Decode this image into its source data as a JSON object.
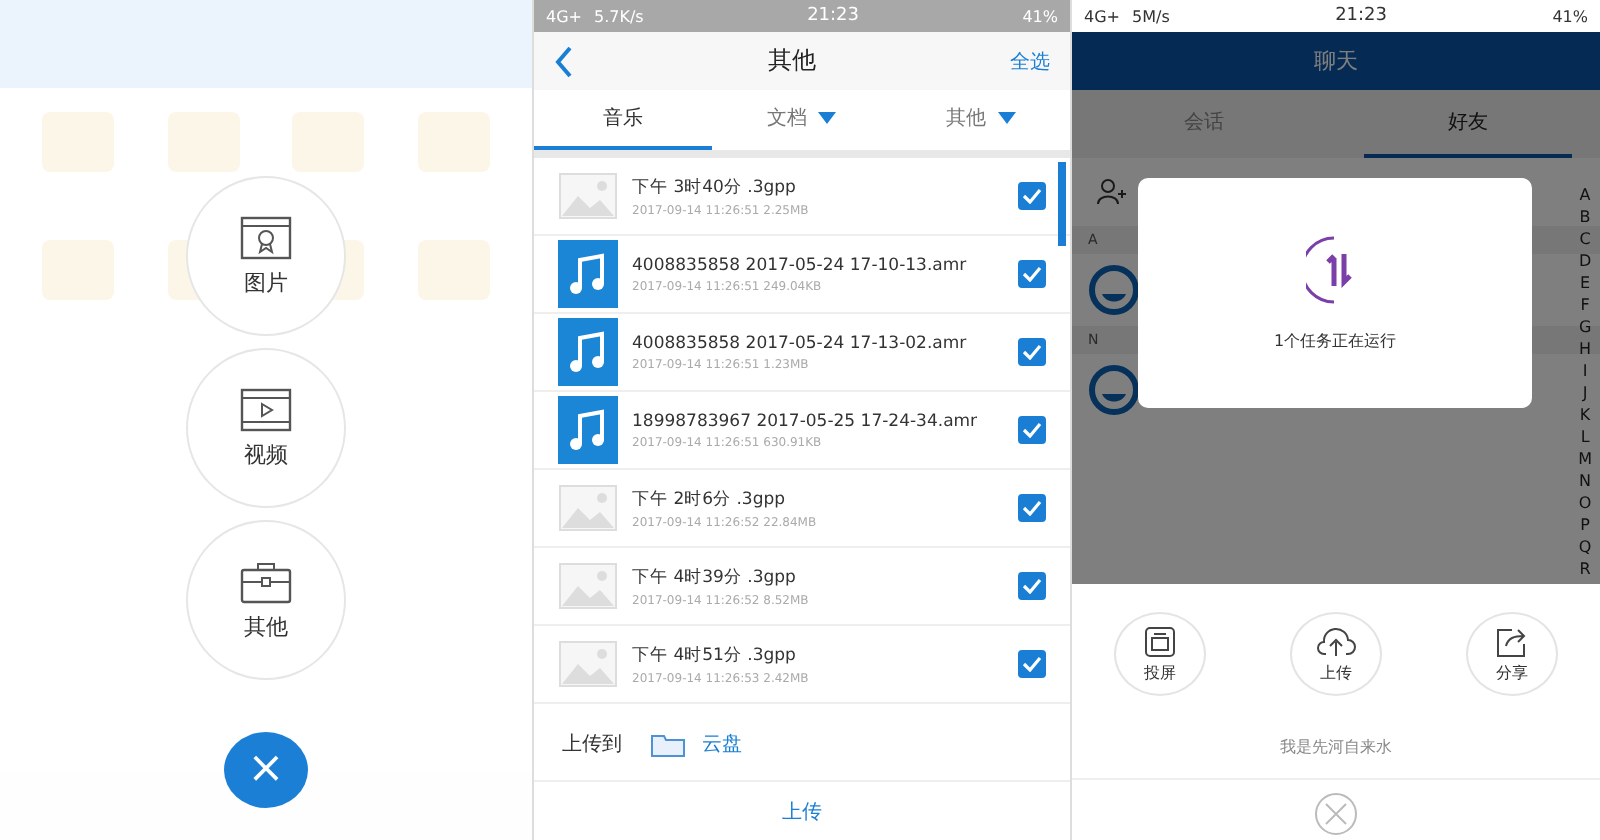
{
  "menu_screen": {
    "options": [
      {
        "label": "图片",
        "kind": "picture"
      },
      {
        "label": "视频",
        "kind": "video"
      },
      {
        "label": "其他",
        "kind": "other"
      }
    ],
    "close": "×"
  },
  "file_screen": {
    "status_bar": {
      "network": "4G+",
      "speed": "5.7K/s",
      "time": "21:23",
      "battery": "41%"
    },
    "title": "其他",
    "select_all": "全选",
    "tabs": [
      {
        "label": "音乐",
        "selected": true,
        "dropdown": false
      },
      {
        "label": "文档",
        "selected": false,
        "dropdown": true
      },
      {
        "label": "其他",
        "selected": false,
        "dropdown": true
      }
    ],
    "files": [
      {
        "name": "下午 3时40分 .3gpp",
        "meta": "2017-09-14 11:26:51  2.25MB",
        "kind": "video",
        "checked": true
      },
      {
        "name": "4008835858 2017-05-24 17-10-13.amr",
        "meta": "2017-09-14 11:26:51  249.04KB",
        "kind": "audio",
        "checked": true
      },
      {
        "name": "4008835858 2017-05-24 17-13-02.amr",
        "meta": "2017-09-14 11:26:51  1.23MB",
        "kind": "audio",
        "checked": true
      },
      {
        "name": "18998783967 2017-05-25 17-24-34.amr",
        "meta": "2017-09-14 11:26:51  630.91KB",
        "kind": "audio",
        "checked": true
      },
      {
        "name": "下午 2时6分 .3gpp",
        "meta": "2017-09-14 11:26:52  22.84MB",
        "kind": "video",
        "checked": true
      },
      {
        "name": "下午 4时39分 .3gpp",
        "meta": "2017-09-14 11:26:52  8.52MB",
        "kind": "video",
        "checked": true
      },
      {
        "name": "下午 4时51分 .3gpp",
        "meta": "2017-09-14 11:26:53  2.42MB",
        "kind": "video",
        "checked": true
      }
    ],
    "upload_to": {
      "label": "上传到",
      "folder": "云盘"
    },
    "upload_button": "上传"
  },
  "chat_screen": {
    "status_bar": {
      "network": "4G+",
      "speed": "5M/s",
      "time": "21:23",
      "battery": "41%"
    },
    "title": "聊天",
    "tabs": [
      {
        "label": "会话",
        "selected": false
      },
      {
        "label": "好友",
        "selected": true
      }
    ],
    "sections": [
      "A",
      "N"
    ],
    "index": [
      "A",
      "B",
      "C",
      "D",
      "E",
      "F",
      "G",
      "H",
      "I",
      "J",
      "K",
      "L",
      "M",
      "N",
      "O",
      "P",
      "Q",
      "R"
    ],
    "dialog": {
      "message": "1个任务正在运行"
    },
    "actions": [
      {
        "label": "投屏",
        "kind": "cast"
      },
      {
        "label": "上传",
        "kind": "upload"
      },
      {
        "label": "分享",
        "kind": "share"
      }
    ],
    "footer": "我是先河自来水"
  }
}
